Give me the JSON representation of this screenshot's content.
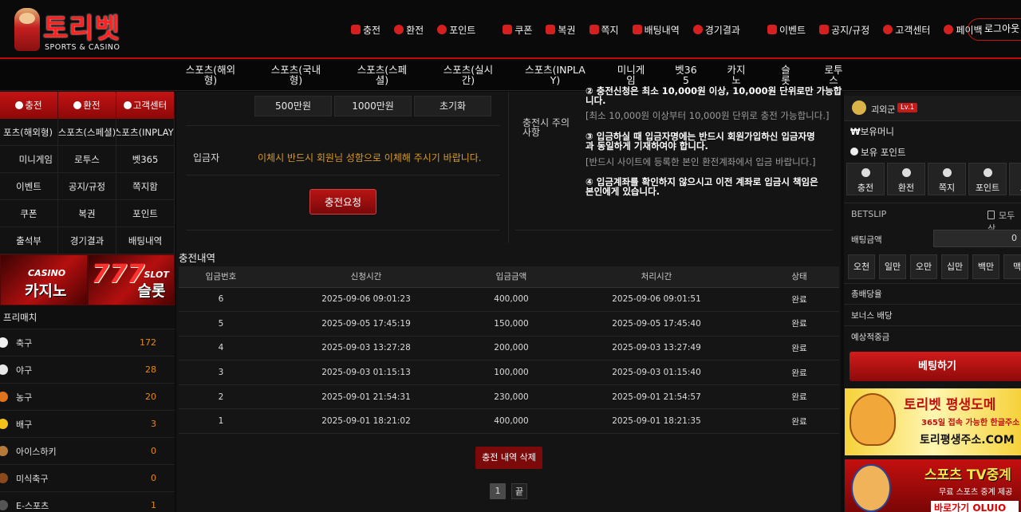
{
  "header": {
    "brand": "토리벳",
    "tagline": "SPORTS & CASINO",
    "nav": [
      "충전",
      "환전",
      "포인트",
      "쿠폰",
      "복권",
      "쪽지",
      "배팅내역",
      "경기결과",
      "이벤트",
      "공지/규정",
      "고객센터",
      "페이백"
    ],
    "logout": "로그아웃"
  },
  "sports_nav": [
    "스포츠(해외\n형)",
    "스포츠(국내\n형)",
    "스포츠(스페\n셜)",
    "스포츠(실시\n간)",
    "스포츠(INPLA\nY)",
    "미니게\n임",
    "벳36\n5",
    "카지\n노",
    "슬\n롯",
    "로투\n스"
  ],
  "sidebar": {
    "quick": [
      "충전",
      "환전",
      "고객센터"
    ],
    "grid": [
      "포츠(해외형)",
      "스포츠(스페셜)",
      "스포츠(INPLAY)",
      "미니게임",
      "로투스",
      "벳365",
      "이벤트",
      "공지/규정",
      "쪽지함",
      "쿠폰",
      "복권",
      "포인트",
      "출석부",
      "경기결과",
      "배팅내역"
    ],
    "banner_casino": {
      "top": "CASINO",
      "label": "카지노"
    },
    "banner_slot": {
      "top": "777",
      "sub": "SLOT",
      "label": "슬롯"
    },
    "prematch": "프리매치",
    "sports": [
      {
        "name": "축구",
        "count": "172",
        "color": "#f0f0f0"
      },
      {
        "name": "야구",
        "count": "28",
        "color": "#e8e8e8"
      },
      {
        "name": "농구",
        "count": "20",
        "color": "#e0731c"
      },
      {
        "name": "배구",
        "count": "3",
        "color": "#f3c21a"
      },
      {
        "name": "아이스하키",
        "count": "0",
        "color": "#b57a3a"
      },
      {
        "name": "미식축구",
        "count": "0",
        "color": "#8a4a1e"
      },
      {
        "name": "E-스포츠",
        "count": "1",
        "color": "#555555"
      }
    ]
  },
  "charge": {
    "amounts": [
      "500만원",
      "1000만원",
      "초기화"
    ],
    "depositor_label": "입금자",
    "depositor_notice": "이체시 반드시 회원님 성함으로 이체해 주시기 바랍니다.",
    "request_button": "충전요청"
  },
  "guide": {
    "title": "충전시 주의\n사항",
    "item2_top": "② 충전신청은 최소 10,000원 이상, 10,000원 단위로만 가능합\n니다.",
    "item2_sub": "[최소 10,000원 이상부터 10,000원 단위로 충전 가능합니다.]",
    "item3": "③ 입금하실 때 입금자명에는 반드시 회원가입하신 입금자명\n과 동일하게 기재하여야 합니다.",
    "item3_sub": "[반드시 사이트에 등록한 본인 환전계좌에서 입금 바랍니다.]",
    "item4": "④ 입금계좌를 확인하지 않으시고 이전 계좌로 입금시 책임은\n본인에게 있습니다."
  },
  "history": {
    "title": "충전내역",
    "columns": [
      "입금번호",
      "신청시간",
      "입금금액",
      "처리시간",
      "상태"
    ],
    "rows": [
      [
        "6",
        "2025-09-06 09:01:23",
        "400,000",
        "2025-09-06 09:01:51",
        "완료"
      ],
      [
        "5",
        "2025-09-05 17:45:19",
        "150,000",
        "2025-09-05 17:45:40",
        "완료"
      ],
      [
        "4",
        "2025-09-03 13:27:28",
        "200,000",
        "2025-09-03 13:27:49",
        "완료"
      ],
      [
        "3",
        "2025-09-03 01:15:13",
        "100,000",
        "2025-09-03 01:15:40",
        "완료"
      ],
      [
        "2",
        "2025-09-01 21:54:31",
        "230,000",
        "2025-09-01 21:54:57",
        "완료"
      ],
      [
        "1",
        "2025-09-01 18:21:02",
        "400,000",
        "2025-09-01 18:21:35",
        "완료"
      ]
    ],
    "delete_button": "충전 내역 삭제",
    "pages": [
      "1",
      "끝"
    ]
  },
  "right": {
    "username": "괴외군",
    "level": "Lv.1",
    "money_label": "보유머니",
    "point_label": "보유 포인트",
    "buttons": [
      "충전",
      "환전",
      "쪽지",
      "포인트",
      "고객"
    ],
    "betslip": "BETSLIP",
    "clear_all": "모두삭",
    "bet_amount_label": "배팅금액",
    "bet_amount_value": "0",
    "chips": [
      "오천",
      "일만",
      "오만",
      "십만",
      "백만",
      "맥"
    ],
    "total_odds": "총배당율",
    "bonus_odds": "보너스 배당",
    "expected": "예상적중금",
    "bet_button": "베팅하기",
    "ad1": {
      "title": "토리벳 평생도메",
      "sub": "365일 접속 가능한 한글주소",
      "url": "토리평생주소.COM"
    },
    "ad2": {
      "title": "스포츠 TV중계",
      "sub": "무료 스포츠 중계 제공",
      "url": "바로가기 OLUIO"
    }
  }
}
